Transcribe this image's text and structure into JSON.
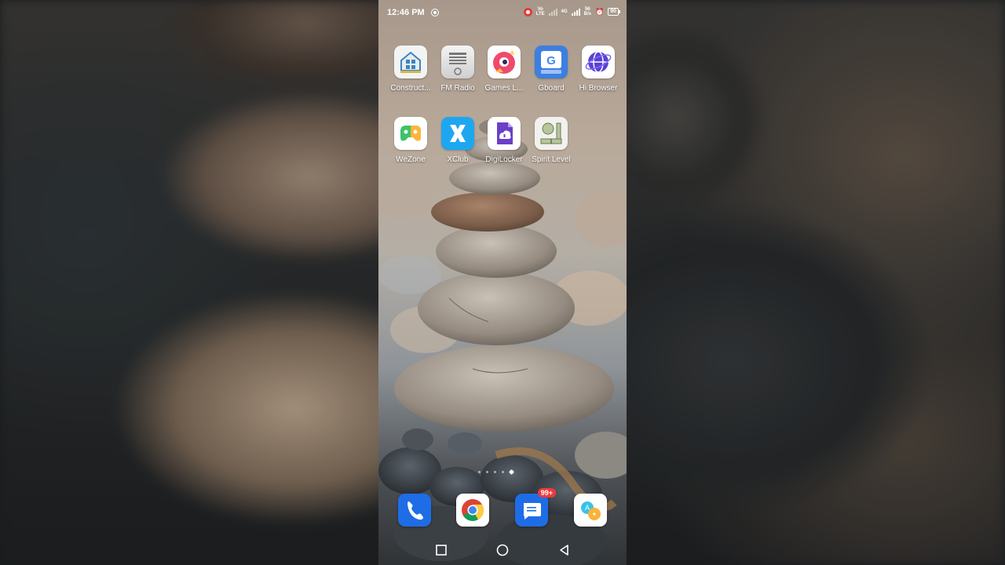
{
  "status_bar": {
    "time": "12:46 PM",
    "volte_top": "Vo",
    "volte_bottom": "LTE",
    "net_type": "4G",
    "speed_top": "56",
    "speed_bottom": "B/s",
    "battery": "90"
  },
  "apps_row1": [
    {
      "label": "Construct...",
      "icon": "construct-icon"
    },
    {
      "label": "FM Radio",
      "icon": "radio-icon"
    },
    {
      "label": "Games L...",
      "icon": "games-icon"
    },
    {
      "label": "Gboard",
      "icon": "gboard-icon"
    },
    {
      "label": "Hi Browser",
      "icon": "browser-icon"
    }
  ],
  "apps_row2": [
    {
      "label": "WeZone",
      "icon": "wezone-icon"
    },
    {
      "label": "XClub",
      "icon": "xclub-icon"
    },
    {
      "label": "DigiLocker",
      "icon": "digilocker-icon"
    },
    {
      "label": "Spirit Level",
      "icon": "spirit-level-icon"
    }
  ],
  "dock": {
    "phone_icon": "phone-icon",
    "chrome_icon": "chrome-icon",
    "messages_icon": "messages-icon",
    "messages_badge": "99+",
    "assistant_icon": "assistant-icon"
  },
  "page_indicator": {
    "count": 5,
    "active": 5
  },
  "colors": {
    "dock_blue": "#1e6de6",
    "badge_red": "#ee3a3a",
    "record_red": "#e43b3b"
  }
}
